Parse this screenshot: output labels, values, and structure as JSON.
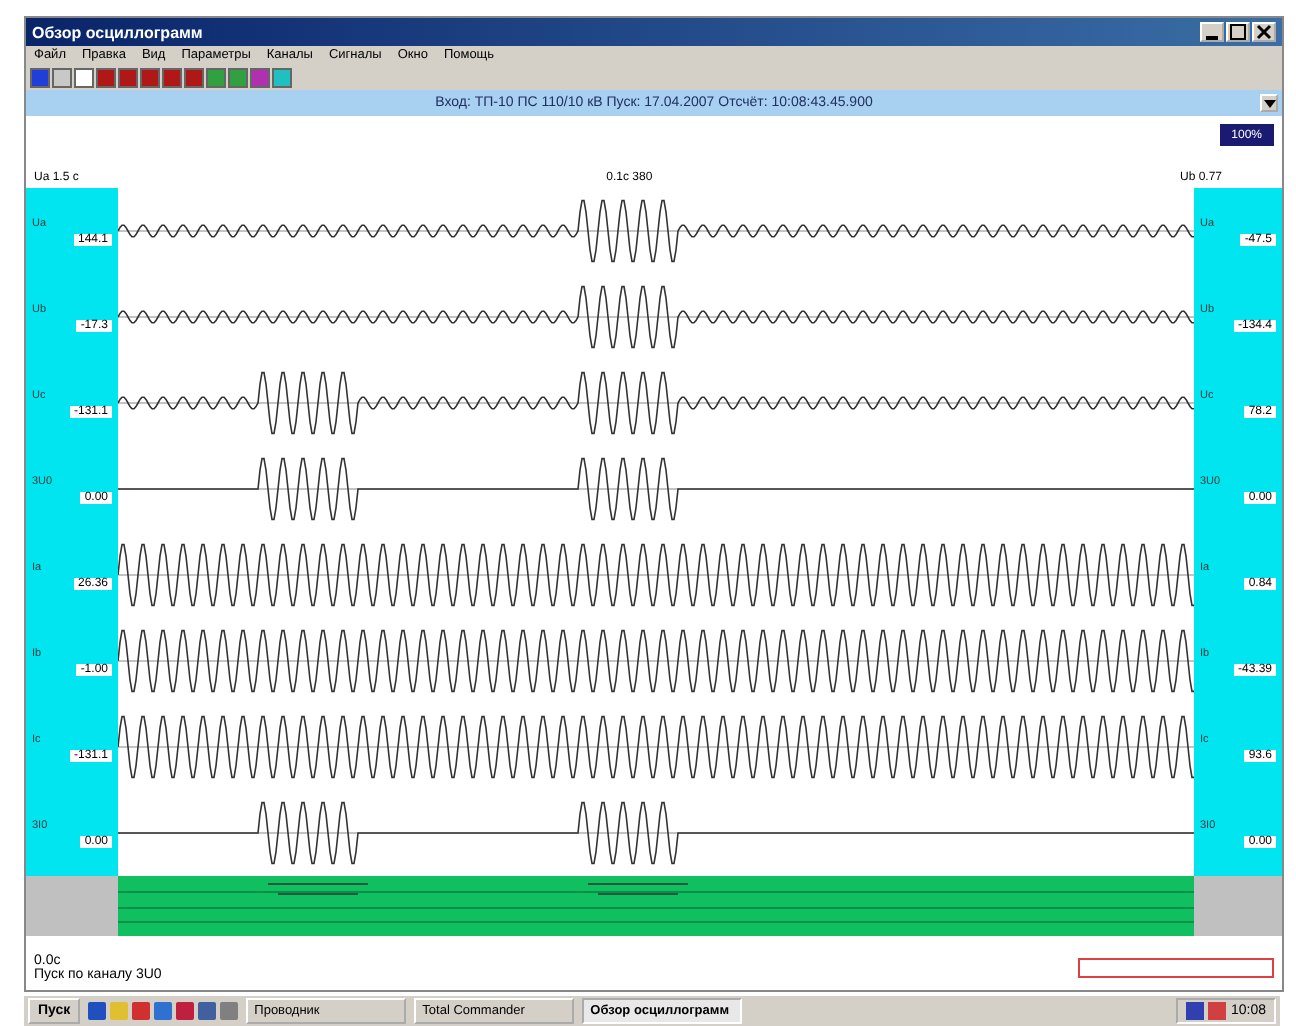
{
  "window": {
    "title": "Обзор осциллограмм"
  },
  "menu": [
    "Файл",
    "Правка",
    "Вид",
    "Параметры",
    "Каналы",
    "Сигналы",
    "Окно",
    "Помощь"
  ],
  "toolbar": [
    {
      "color": "#1f3fd8"
    },
    {
      "color": "#c8c8c8"
    },
    {
      "color": "#ffffff"
    },
    {
      "color": "#b01818"
    },
    {
      "color": "#b01818"
    },
    {
      "color": "#b01818"
    },
    {
      "color": "#b01818"
    },
    {
      "color": "#b01818"
    },
    {
      "color": "#30a040"
    },
    {
      "color": "#30a040"
    },
    {
      "color": "#b030b0"
    },
    {
      "color": "#20c0c0"
    }
  ],
  "info_bar": "Вход: ТП-10 ПС 110/10 кВ    Пуск: 17.04.2007    Отсчёт: 10:08:43.45.900",
  "zoom_button": "100%",
  "header": {
    "left": "Ua 1.5 с",
    "center": "0.1с 380",
    "right": "Ub 0.77"
  },
  "channels": [
    {
      "name": "Ua",
      "kind": "small-one-burst",
      "left_value": "144.1",
      "right_name": "Ua",
      "right_value": "-47.5"
    },
    {
      "name": "Ub",
      "kind": "small-one-burst",
      "left_value": "-17.3",
      "right_name": "Ub",
      "right_value": "-134.4"
    },
    {
      "name": "Uc",
      "kind": "small-two-bursts",
      "left_value": "-131.1",
      "right_name": "Uc",
      "right_value": "78.2"
    },
    {
      "name": "3U0",
      "kind": "flat-two-bursts",
      "left_value": "0.00",
      "right_name": "3U0",
      "right_value": "0.00"
    },
    {
      "name": "Ia",
      "kind": "large",
      "left_value": "26.36",
      "right_name": "Ia",
      "right_value": "0.84"
    },
    {
      "name": "Ib",
      "kind": "large",
      "left_value": "-1.00",
      "right_name": "Ib",
      "right_value": "-43.39"
    },
    {
      "name": "Ic",
      "kind": "large",
      "left_value": "-131.1",
      "right_name": "Ic",
      "right_value": "93.6"
    },
    {
      "name": "3I0",
      "kind": "flat-two-bursts",
      "left_value": "0.00",
      "right_name": "3I0",
      "right_value": "0.00"
    }
  ],
  "status": {
    "time": "0.0с",
    "message": "Пуск по каналу 3U0"
  },
  "taskbar": {
    "start": "Пуск",
    "tasks": [
      {
        "label": "Проводник",
        "selected": false
      },
      {
        "label": "Total Commander",
        "selected": false
      },
      {
        "label": "Обзор осциллограмм",
        "selected": true
      }
    ],
    "clock": "10:08"
  }
}
